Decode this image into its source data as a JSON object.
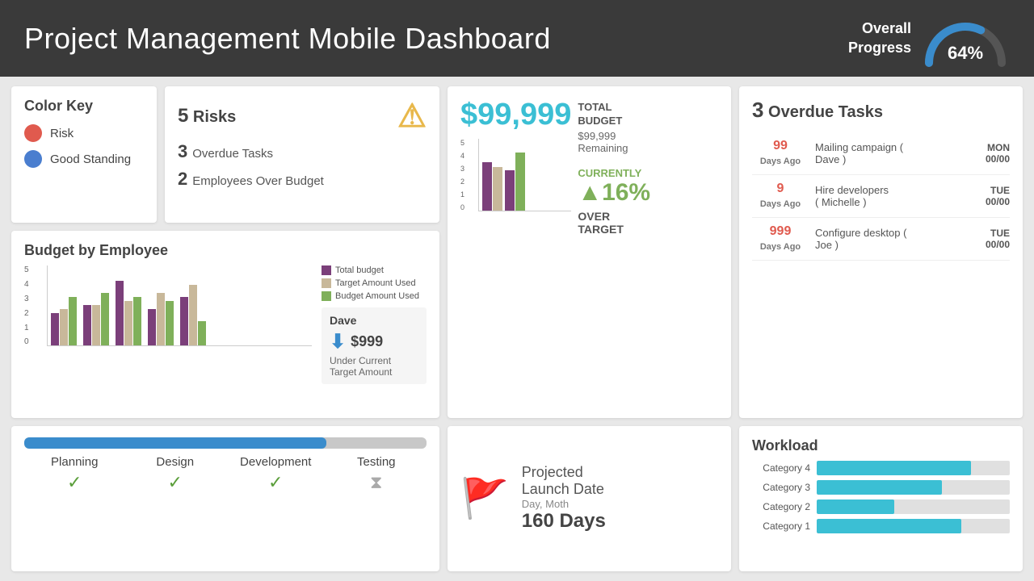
{
  "header": {
    "title": "Project Management Mobile Dashboard",
    "overall_progress_label": "Overall\nProgress",
    "overall_progress_pct": "64%",
    "gauge_pct": 64
  },
  "color_key": {
    "title": "Color Key",
    "items": [
      {
        "label": "Risk",
        "color": "#e05a4e"
      },
      {
        "label": "Good Standing",
        "color": "#4a7ecf"
      }
    ]
  },
  "risks": {
    "count": "5",
    "label": "Risks",
    "overdue_tasks": {
      "count": "3",
      "label": "Overdue Tasks"
    },
    "employees_over_budget": {
      "count": "2",
      "label": "Employees Over Budget"
    }
  },
  "budget_employee": {
    "title": "Budget by Employee",
    "legend": [
      {
        "label": "Total budget",
        "color": "#7b3f7a"
      },
      {
        "label": "Target Amount Used",
        "color": "#c8b89a"
      },
      {
        "label": "Budget Amount Used",
        "color": "#7fb05a"
      }
    ],
    "bars": [
      {
        "purple": 40,
        "tan": 45,
        "green": 60
      },
      {
        "purple": 50,
        "tan": 50,
        "green": 65
      },
      {
        "purple": 80,
        "tan": 55,
        "green": 60
      },
      {
        "purple": 45,
        "tan": 65,
        "green": 55
      },
      {
        "purple": 60,
        "tan": 75,
        "green": 30
      }
    ],
    "y_labels": [
      "5",
      "4",
      "3",
      "2",
      "1",
      "0"
    ]
  },
  "dave": {
    "name": "Dave",
    "amount": "$999",
    "subtitle": "Under Current\nTarget Amount"
  },
  "total_budget": {
    "amount": "$99,999",
    "label": "TOTAL\nBUDGET",
    "remaining": "$99,999\nRemaining",
    "currently_label": "CURRENTLY",
    "pct": "▲16%",
    "over_target": "OVER\nTARGET",
    "y_labels": [
      "5",
      "4",
      "3",
      "2",
      "1",
      "0"
    ]
  },
  "projected_launch": {
    "title": "Projected\nLaunch Date",
    "subtitle": "Day, Moth",
    "days": "160 Days"
  },
  "overdue_tasks": {
    "count": "3",
    "title": "Overdue Tasks",
    "items": [
      {
        "days": "99\nDays Ago",
        "desc": "Mailing campaign (\nDave )",
        "day": "MON",
        "date": "00/00"
      },
      {
        "days": "9\nDays Ago",
        "desc": "Hire developers\n( Michelle )",
        "day": "TUE",
        "date": "00/00"
      },
      {
        "days": "999\nDays Ago",
        "desc": "Configure desktop (\nJoe )",
        "day": "TUE",
        "date": "00/00"
      }
    ]
  },
  "workload": {
    "title": "Workload",
    "categories": [
      {
        "label": "Category 4",
        "pct": 80
      },
      {
        "label": "Category 3",
        "pct": 65
      },
      {
        "label": "Category 2",
        "pct": 40
      },
      {
        "label": "Category 1",
        "pct": 75
      }
    ]
  },
  "progress": {
    "bar_pct": 75,
    "stages": [
      {
        "label": "Planning",
        "done": true
      },
      {
        "label": "Design",
        "done": true
      },
      {
        "label": "Development",
        "done": true
      },
      {
        "label": "Testing",
        "done": false
      }
    ]
  }
}
